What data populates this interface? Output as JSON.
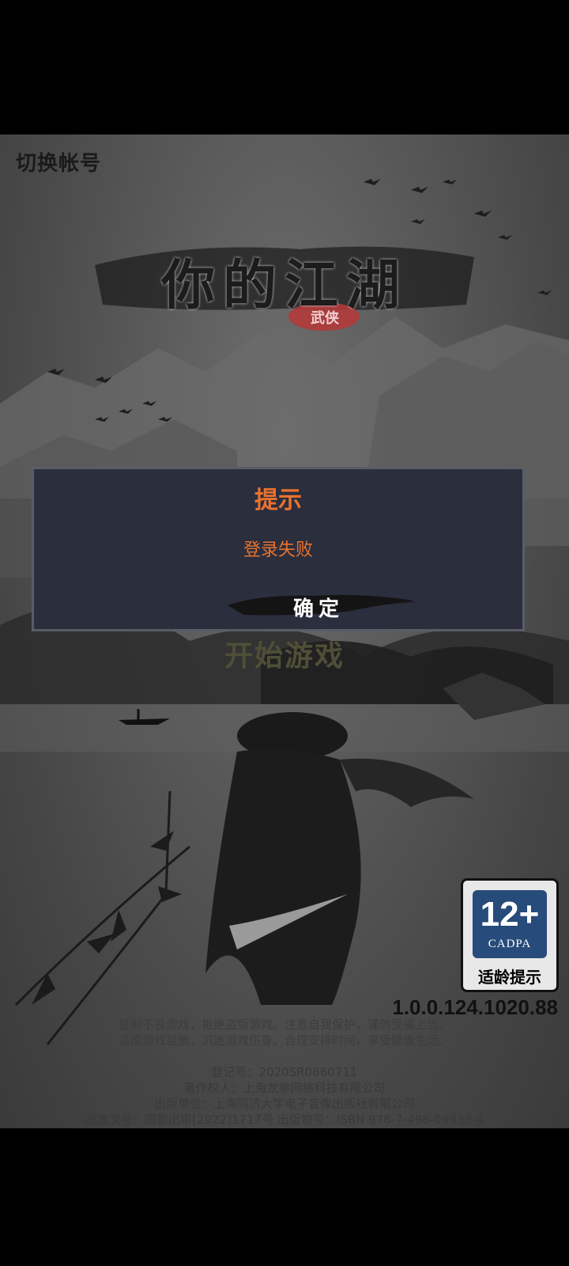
{
  "header": {
    "switch_account": "切换帐号"
  },
  "logo": {
    "title": "你的江湖",
    "genre_seal": "武侠"
  },
  "dialog": {
    "title": "提示",
    "message": "登录失败",
    "confirm_label": "确定"
  },
  "start_game_label": "开始游戏",
  "age_rating": {
    "age": "12+",
    "org": "CADPA",
    "label": "适龄提示"
  },
  "version": "1.0.0.124.1020.88",
  "health_notice": [
    "抵制不良游戏，拒绝盗版游戏。注意自我保护，谨防受骗上当。",
    "适度游戏益脑，沉迷游戏伤身。合理安排时间，享受健康生活。"
  ],
  "legal": {
    "registration": "登记号：2020SR0660711",
    "copyright": "著作权人：上海龙拳网络科技有限公司",
    "publisher": "出版单位：上海同济大学电子音像出版社有限公司",
    "approval": "批准文号：国新出审[2022]1717号 出版物号：ISBN 978-7-498-09933-4"
  },
  "colors": {
    "dialog_bg": "#2b2e3d",
    "accent": "#e8722f",
    "seal_red": "#b23a3a",
    "badge_blue": "#274b7a"
  }
}
